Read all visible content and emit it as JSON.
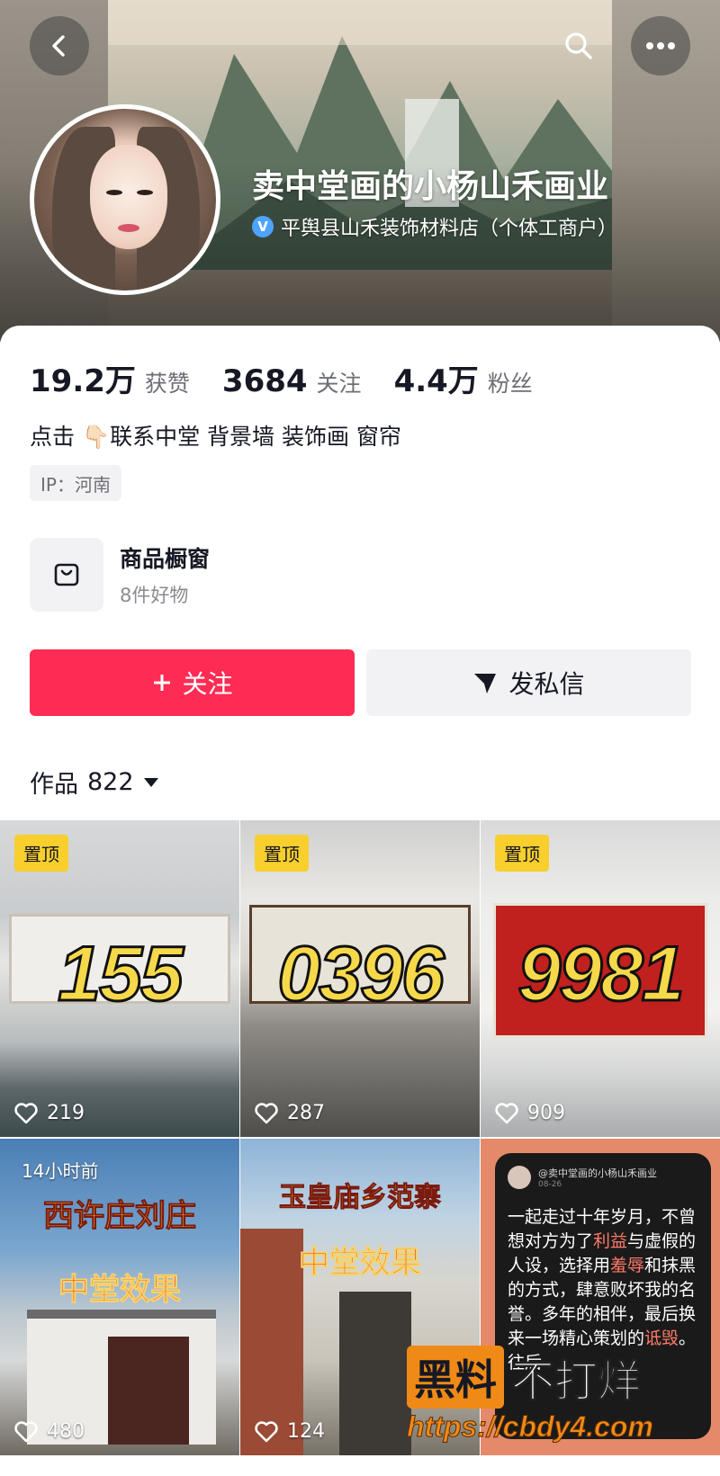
{
  "header": {
    "name": "卖中堂画的小杨山禾画业",
    "verified_label": "平舆县山禾装饰材料店（个体工商户）"
  },
  "stats": [
    {
      "value": "19.2万",
      "label": "获赞"
    },
    {
      "value": "3684",
      "label": "关注"
    },
    {
      "value": "4.4万",
      "label": "粉丝"
    }
  ],
  "bio": "点击 👇🏻联系中堂 背景墙 装饰画 窗帘",
  "ip": "IP：河南",
  "shop": {
    "title": "商品橱窗",
    "subtitle": "8件好物"
  },
  "actions": {
    "follow": "关注",
    "message": "发私信"
  },
  "works": {
    "label": "作品",
    "count": "822"
  },
  "grid": [
    {
      "pin": "置顶",
      "overlay": "155",
      "likes": "219"
    },
    {
      "pin": "置顶",
      "overlay": "0396",
      "likes": "287"
    },
    {
      "pin": "置顶",
      "overlay": "9981",
      "likes": "909"
    },
    {
      "time": "14小时前",
      "title1": "西许庄刘庄",
      "title2": "中堂效果",
      "likes": "480"
    },
    {
      "title1": "玉皇庙乡范寨",
      "title2": "中堂效果",
      "likes": "124"
    },
    {
      "note_name": "@卖中堂画的小杨山禾画业",
      "note_date": "08-26"
    }
  ],
  "watermark": {
    "box": "黑料",
    "text": "不打烊",
    "url": "https://cbdy4.com"
  },
  "colors": {
    "follow": "#fe2c55",
    "pin": "#f8cf2d",
    "digits": "#f6d94a"
  }
}
